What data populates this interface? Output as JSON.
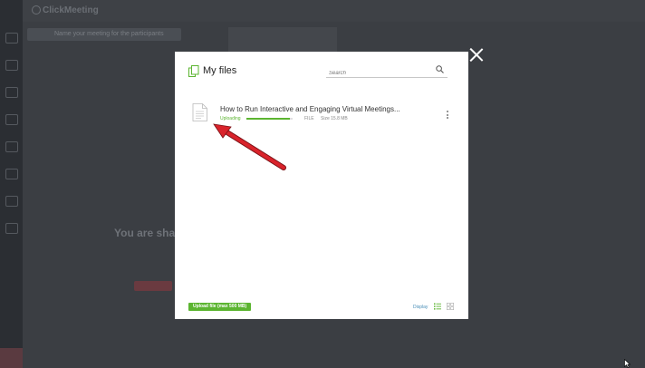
{
  "background": {
    "brand": "ClickMeeting",
    "meeting_name_hint": "Name your meeting for the participants",
    "shared_heading": "You are sha"
  },
  "modal": {
    "title": "My files",
    "search_placeholder": "Search",
    "file": {
      "name": "How to Run Interactive and Engaging Virtual Meetings...",
      "status": "Uploading",
      "progress": 0.95,
      "type": "FILE",
      "size": "Size 15.8 MB"
    },
    "upload_button": "Upload file (max 500 MB)",
    "display_label": "Display"
  },
  "colors": {
    "accent_green": "#5cb531",
    "annotation_red": "#d9232b"
  },
  "icons": {
    "files": "files-icon",
    "search": "search-icon",
    "document": "document-icon",
    "more": "kebab-menu-icon",
    "close": "close-icon",
    "list_view": "list-view-icon",
    "grid_view": "grid-view-icon"
  }
}
